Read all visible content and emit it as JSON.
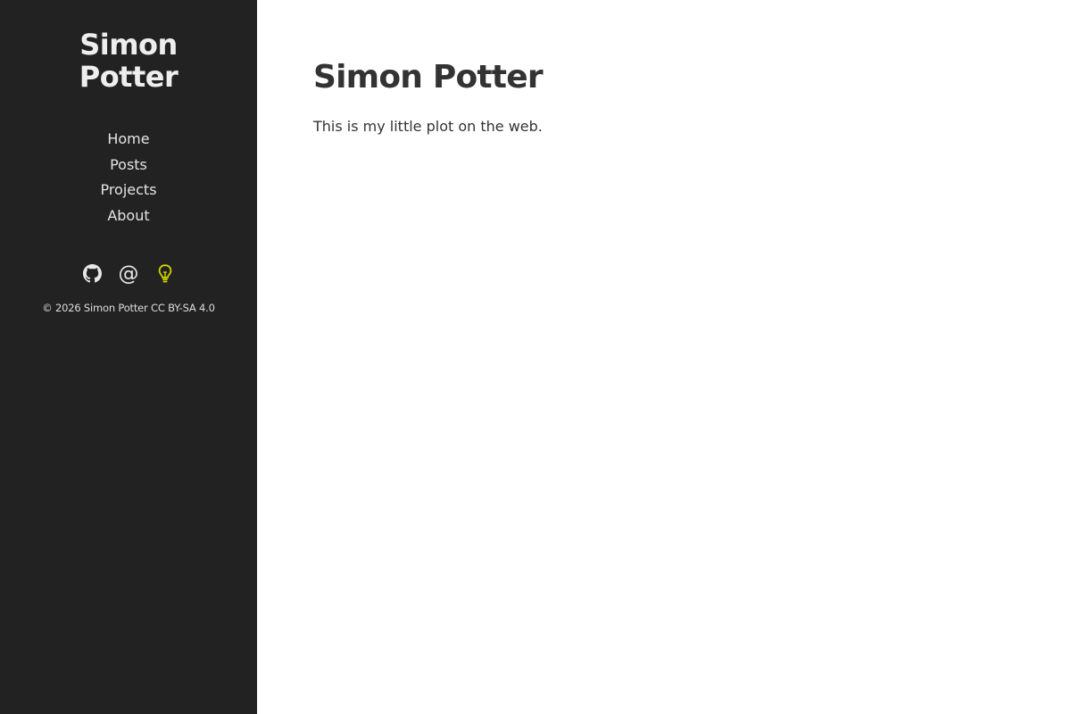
{
  "sidebar": {
    "site_title": "Simon Potter",
    "nav": [
      {
        "label": "Home"
      },
      {
        "label": "Posts"
      },
      {
        "label": "Projects"
      },
      {
        "label": "About"
      }
    ],
    "social": [
      {
        "icon": "github-icon",
        "color": "#e8e8e8"
      },
      {
        "icon": "at-icon",
        "glyph": "@",
        "color": "#e8e8e8"
      },
      {
        "icon": "lightbulb-icon",
        "color": "#d4d400"
      }
    ],
    "footer": "© 2026 Simon Potter CC BY-SA 4.0",
    "background": "#222222"
  },
  "main": {
    "title": "Simon Potter",
    "intro": "This is my little plot on the web."
  }
}
